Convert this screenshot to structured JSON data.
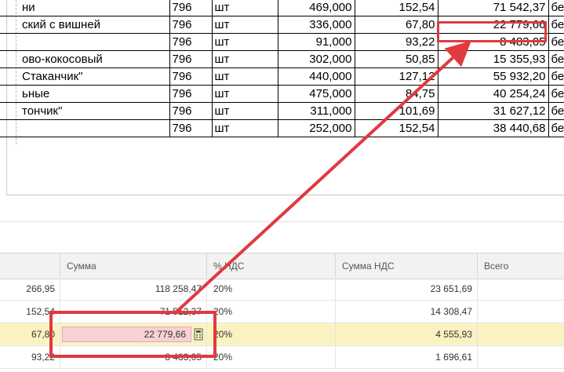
{
  "print_rows": [
    {
      "name": "ни",
      "code": "796",
      "unit": "шт",
      "qty": "469,000",
      "price": "152,54",
      "sum": "71 542,37",
      "vat": "бе"
    },
    {
      "name": "ский с вишней",
      "code": "796",
      "unit": "шт",
      "qty": "336,000",
      "price": "67,80",
      "sum": "22 779,66",
      "vat": "бе"
    },
    {
      "name": "",
      "code": "796",
      "unit": "шт",
      "qty": "91,000",
      "price": "93,22",
      "sum": "8 483,05",
      "vat": "бе"
    },
    {
      "name": "ово-кокосовый",
      "code": "796",
      "unit": "шт",
      "qty": "302,000",
      "price": "50,85",
      "sum": "15 355,93",
      "vat": "бе"
    },
    {
      "name": "Стаканчик\"",
      "code": "796",
      "unit": "шт",
      "qty": "440,000",
      "price": "127,12",
      "sum": "55 932,20",
      "vat": "бе"
    },
    {
      "name": "ьные",
      "code": "796",
      "unit": "шт",
      "qty": "475,000",
      "price": "84,75",
      "sum": "40 254,24",
      "vat": "бе"
    },
    {
      "name": "тончик\"",
      "code": "796",
      "unit": "шт",
      "qty": "311,000",
      "price": "101,69",
      "sum": "31 627,12",
      "vat": "бе"
    },
    {
      "name": "",
      "code": "796",
      "unit": "шт",
      "qty": "252,000",
      "price": "152,54",
      "sum": "38 440,68",
      "vat": "бе"
    }
  ],
  "grid": {
    "columns": {
      "sum": "Сумма",
      "vat_rate": "% НДС",
      "vat_sum": "Сумма НДС",
      "total": "Всего"
    },
    "rows": [
      {
        "price": "266,95",
        "sum": "118 258,47",
        "vat_rate": "20%",
        "vat_sum": "23 651,69",
        "total": ""
      },
      {
        "price": "152,54",
        "sum": "71 512,37",
        "vat_rate": "20%",
        "vat_sum": "14 308,47",
        "total": ""
      },
      {
        "price": "67,80",
        "sum": "22 779,66",
        "vat_rate": "20%",
        "vat_sum": "4 555,93",
        "total": "",
        "editing": true
      },
      {
        "price": "93,22",
        "sum": "8 483,05",
        "vat_rate": "20%",
        "vat_sum": "1 696,61",
        "total": ""
      }
    ]
  },
  "icons": {
    "calculator": "calculator-icon"
  },
  "colors": {
    "annotation": "#e03a3e",
    "selected_row": "#fbf2c2",
    "edit_field": "#f7d2d4"
  }
}
